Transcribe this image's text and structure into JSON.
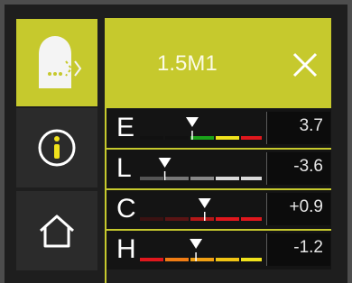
{
  "header": {
    "title": "1.5M1",
    "close_icon": "close-icon"
  },
  "sidebar": {
    "items": [
      {
        "icon": "hearing-device-icon",
        "selected": true
      },
      {
        "icon": "info-icon",
        "selected": false
      },
      {
        "icon": "home-icon",
        "selected": false
      }
    ]
  },
  "colors": {
    "accent": "#c6c92d",
    "green": "#1aa31a",
    "yellow": "#f0e21c",
    "red": "#e0171d",
    "orange": "#f07c14",
    "gray_light": "#d9d9d9",
    "gray_dark": "#555555",
    "dark_red": "#3a1212"
  },
  "rows": [
    {
      "letter": "E",
      "value": "3.7",
      "segments": [
        "#111111",
        "#111111",
        "#1aa31a",
        "#f0e21c",
        "#e0171d"
      ],
      "marker_fraction": 0.42
    },
    {
      "letter": "L",
      "value": "-3.6",
      "segments": [
        "#555555",
        "#777777",
        "#888888",
        "#d9d9d9",
        "#d9d9d9"
      ],
      "marker_fraction": 0.2
    },
    {
      "letter": "C",
      "value": "+0.9",
      "segments": [
        "#3a1212",
        "#5a1414",
        "#b51818",
        "#e0171d",
        "#e0171d"
      ],
      "marker_fraction": 0.52
    },
    {
      "letter": "H",
      "value": "-1.2",
      "segments": [
        "#e0171d",
        "#f07c14",
        "#f0a014",
        "#f0c414",
        "#f0e21c"
      ],
      "marker_fraction": 0.45
    }
  ]
}
